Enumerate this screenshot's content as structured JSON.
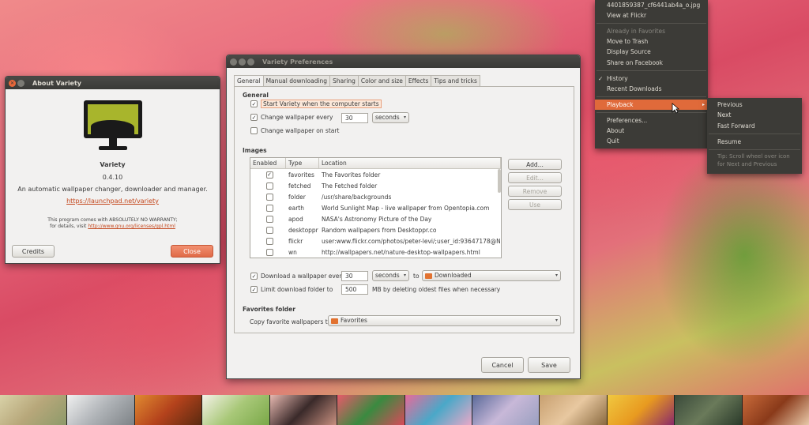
{
  "about_window": {
    "title": "About Variety",
    "app_name": "Variety",
    "version": "0.4.10",
    "description": "An automatic wallpaper changer, downloader and manager.",
    "link": "https://launchpad.net/variety",
    "warranty_line1": "This program comes with ABSOLUTELY NO WARRANTY;",
    "warranty_prefix": "for details, visit ",
    "warranty_link": "http://www.gnu.org/licenses/gpl.html",
    "credits_button": "Credits",
    "close_button": "Close"
  },
  "prefs_window": {
    "title": "Variety Preferences",
    "tabs": [
      "General",
      "Manual downloading",
      "Sharing",
      "Color and size",
      "Effects",
      "Tips and tricks"
    ],
    "general_heading": "General",
    "start_on_login": "Start Variety when the computer starts",
    "change_every": "Change wallpaper every",
    "change_value": "30",
    "change_unit": "seconds",
    "change_on_start": "Change wallpaper on start",
    "images_heading": "Images",
    "table_headers": [
      "Enabled",
      "Type",
      "Location"
    ],
    "table_rows": [
      {
        "enabled": true,
        "type": "favorites",
        "location": "The Favorites folder"
      },
      {
        "enabled": false,
        "type": "fetched",
        "location": "The Fetched folder"
      },
      {
        "enabled": false,
        "type": "folder",
        "location": "/usr/share/backgrounds"
      },
      {
        "enabled": false,
        "type": "earth",
        "location": "World Sunlight Map - live wallpaper from Opentopia.com"
      },
      {
        "enabled": false,
        "type": "apod",
        "location": "NASA's Astronomy Picture of the Day"
      },
      {
        "enabled": false,
        "type": "desktoppr",
        "location": "Random wallpapers from Desktoppr.co"
      },
      {
        "enabled": false,
        "type": "flickr",
        "location": "user:www.flickr.com/photos/peter-levi/;user_id:93647178@N00;"
      },
      {
        "enabled": false,
        "type": "wn",
        "location": "http://wallpapers.net/nature-desktop-wallpapers.html"
      }
    ],
    "add_button": "Add...",
    "edit_button": "Edit...",
    "remove_button": "Remove",
    "use_button": "Use",
    "download_every": "Download a wallpaper every",
    "download_value": "30",
    "download_unit": "seconds",
    "to_label": "to",
    "download_folder": "Downloaded",
    "limit_label": "Limit download folder to",
    "limit_value": "500",
    "limit_suffix": "MB by deleting oldest files when necessary",
    "favorites_heading": "Favorites folder",
    "copy_favorites_label": "Copy favorite wallpapers to",
    "favorites_folder": "Favorites",
    "cancel_button": "Cancel",
    "save_button": "Save"
  },
  "tray_menu": {
    "items": [
      {
        "label": "4401859387_cf6441ab4a_o.jpg",
        "disabled": false
      },
      {
        "label": "View at Flickr",
        "disabled": false
      },
      {
        "label": "Already in Favorites",
        "disabled": true
      },
      {
        "label": "Move to Trash",
        "disabled": false
      },
      {
        "label": "Display Source",
        "disabled": false
      },
      {
        "label": "Share on Facebook",
        "disabled": false
      },
      {
        "label": "History",
        "disabled": false,
        "checked": true
      },
      {
        "label": "Recent Downloads",
        "disabled": false
      },
      {
        "label": "Playback",
        "disabled": false,
        "selected": true,
        "submenu": true
      },
      {
        "label": "Preferences...",
        "disabled": false
      },
      {
        "label": "About",
        "disabled": false
      },
      {
        "label": "Quit",
        "disabled": false
      }
    ],
    "submenu": {
      "previous": "Previous",
      "next": "Next",
      "fast_forward": "Fast Forward",
      "resume": "Resume",
      "tip": "Tip: Scroll wheel over icon for Next and Previous"
    }
  },
  "colors": {
    "accent": "#e06a3a",
    "menu_bg": "#3c3b37",
    "link": "#c3461c"
  }
}
